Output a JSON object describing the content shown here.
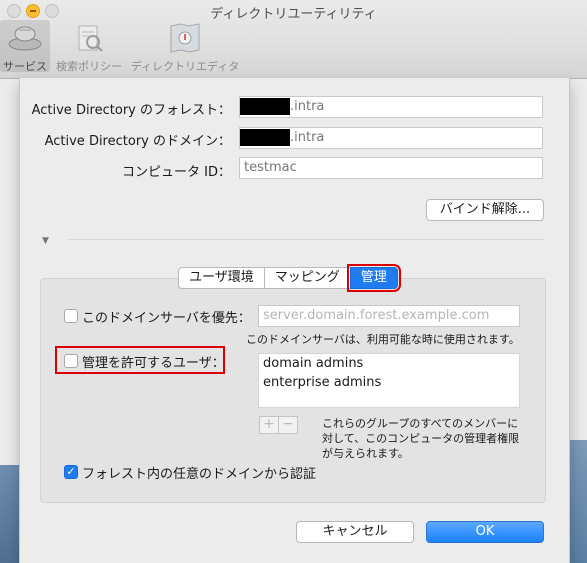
{
  "window": {
    "title": "ディレクトリユーティリティ"
  },
  "toolbar": {
    "items": [
      {
        "label": "サービス",
        "icon": "services-icon",
        "selected": true
      },
      {
        "label": "検索ポリシー",
        "icon": "search-policy-icon",
        "selected": false
      },
      {
        "label": "ディレクトリエディタ",
        "icon": "directory-editor-icon",
        "selected": false
      }
    ]
  },
  "form": {
    "forest_label": "Active Directory のフォレスト：",
    "forest_value": ".intra",
    "domain_label": "Active Directory のドメイン：",
    "domain_value": ".intra",
    "computer_id_label": "コンピュータ ID：",
    "computer_id_value": "testmac",
    "unbind_button": "バインド解除..."
  },
  "tabs": [
    {
      "label": "ユーザ環境",
      "active": false
    },
    {
      "label": "マッピング",
      "active": false
    },
    {
      "label": "管理",
      "active": true
    }
  ],
  "admin": {
    "prefer_server_label": "このドメインサーバを優先：",
    "prefer_server_placeholder": "server.domain.forest.example.com",
    "prefer_server_note": "このドメインサーバは、利用可能な時に使用されます。",
    "allow_admin_label": "管理を許可するユーザ：",
    "admin_groups": [
      "domain admins",
      "enterprise admins"
    ],
    "admin_note_lines": [
      "これらのグループのすべてのメンバーに",
      "対して、このコンピュータの管理者権限",
      "が与えられます。"
    ],
    "add_symbol": "+",
    "remove_symbol": "−",
    "forest_auth_label": "フォレスト内の任意のドメインから認証",
    "forest_auth_checked": true,
    "check_mark": "✓"
  },
  "buttons": {
    "cancel": "キャンセル",
    "ok": "OK"
  },
  "colors": {
    "accent": "#1e7cf0",
    "highlight": "#d90000"
  }
}
